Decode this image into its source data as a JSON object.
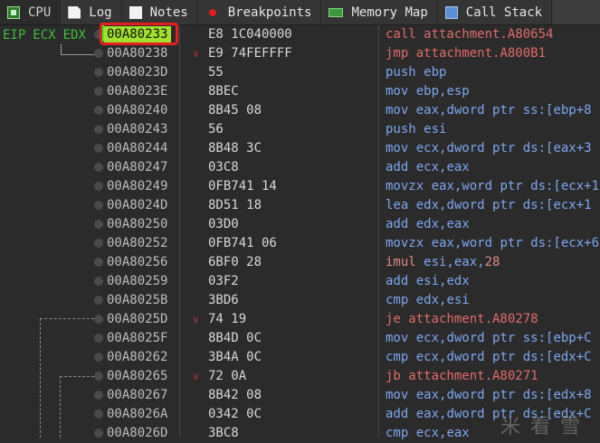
{
  "tabs": [
    {
      "label": "CPU",
      "icon": "cpu-icon",
      "active": true
    },
    {
      "label": "Log",
      "icon": "document-icon"
    },
    {
      "label": "Notes",
      "icon": "notes-icon"
    },
    {
      "label": "Breakpoints",
      "icon": "breakpoint-dot-icon"
    },
    {
      "label": "Memory Map",
      "icon": "memory-map-icon"
    },
    {
      "label": "Call Stack",
      "icon": "call-stack-icon"
    }
  ],
  "registers": [
    "EIP",
    "ECX",
    "EDX"
  ],
  "rows": [
    {
      "addr": "00A80233",
      "bytes": "E8 1C040000",
      "mn": "call",
      "ops": " attachment.A80654",
      "cls": "call",
      "current": true
    },
    {
      "addr": "00A80238",
      "bytes": "E9 74FEFFFF",
      "mn": "jmp",
      "ops": " attachment.A800B1",
      "cls": "jmp",
      "jump": true
    },
    {
      "addr": "00A8023D",
      "bytes": "55",
      "mn": "push",
      "ops": " ebp",
      "cls": "op"
    },
    {
      "addr": "00A8023E",
      "bytes": "8BEC",
      "mn": "mov",
      "ops": " ebp,esp",
      "cls": "op"
    },
    {
      "addr": "00A80240",
      "bytes": "8B45 08",
      "mn": "mov",
      "ops": " eax,dword ptr ss:[ebp+8",
      "cls": "op"
    },
    {
      "addr": "00A80243",
      "bytes": "56",
      "mn": "push",
      "ops": " esi",
      "cls": "op"
    },
    {
      "addr": "00A80244",
      "bytes": "8B48 3C",
      "mn": "mov",
      "ops": " ecx,dword ptr ds:[eax+3",
      "cls": "op"
    },
    {
      "addr": "00A80247",
      "bytes": "03C8",
      "mn": "add",
      "ops": " ecx,eax",
      "cls": "op"
    },
    {
      "addr": "00A80249",
      "bytes": "0FB741 14",
      "mn": "movzx",
      "ops": " eax,word ptr ds:[ecx+1",
      "cls": "op"
    },
    {
      "addr": "00A8024D",
      "bytes": "8D51 18",
      "mn": "lea",
      "ops": " edx,dword ptr ds:[ecx+1",
      "cls": "op"
    },
    {
      "addr": "00A80250",
      "bytes": "03D0",
      "mn": "add",
      "ops": " edx,eax",
      "cls": "op"
    },
    {
      "addr": "00A80252",
      "bytes": "0FB741 06",
      "mn": "movzx",
      "ops": " eax,word ptr ds:[ecx+6",
      "cls": "op"
    },
    {
      "addr": "00A80256",
      "bytes": "6BF0 28",
      "mn": "imul",
      "ops": " esi,eax,",
      "num": "28",
      "cls": "imul"
    },
    {
      "addr": "00A80259",
      "bytes": "03F2",
      "mn": "add",
      "ops": " esi,edx",
      "cls": "op"
    },
    {
      "addr": "00A8025B",
      "bytes": "3BD6",
      "mn": "cmp",
      "ops": " edx,esi",
      "cls": "op"
    },
    {
      "addr": "00A8025D",
      "bytes": "74 19",
      "mn": "je",
      "ops": " attachment.A80278",
      "cls": "jmp",
      "jump": true
    },
    {
      "addr": "00A8025F",
      "bytes": "8B4D 0C",
      "mn": "mov",
      "ops": " ecx,dword ptr ss:[ebp+C",
      "cls": "op"
    },
    {
      "addr": "00A80262",
      "bytes": "3B4A 0C",
      "mn": "cmp",
      "ops": " ecx,dword ptr ds:[edx+C",
      "cls": "op"
    },
    {
      "addr": "00A80265",
      "bytes": "72 0A",
      "mn": "jb",
      "ops": " attachment.A80271",
      "cls": "jmp",
      "jump": true
    },
    {
      "addr": "00A80267",
      "bytes": "8B42 08",
      "mn": "mov",
      "ops": " eax,dword ptr ds:[edx+8",
      "cls": "op"
    },
    {
      "addr": "00A8026A",
      "bytes": "0342 0C",
      "mn": "add",
      "ops": " eax,dword ptr ds:[edx+C",
      "cls": "op"
    },
    {
      "addr": "00A8026D",
      "bytes": "3BC8",
      "mn": "cmp",
      "ops": " ecx,eax",
      "cls": "op"
    }
  ],
  "watermark": "米  看  雪"
}
